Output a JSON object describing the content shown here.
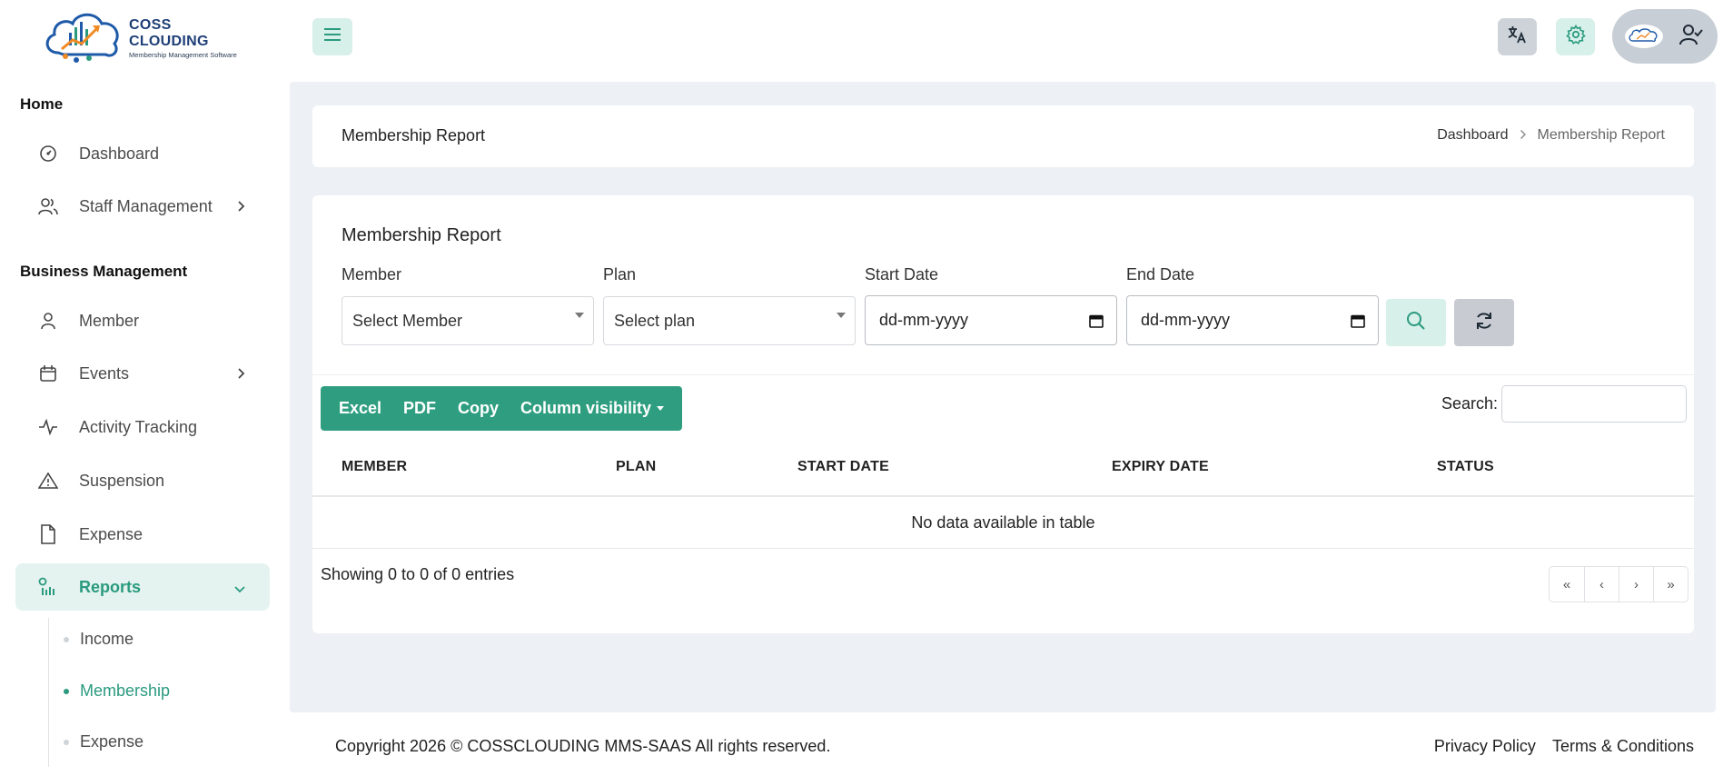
{
  "brand": {
    "name": "COSS CLOUDING",
    "tagline": "Membership Management Software"
  },
  "sidebar": {
    "sections": [
      {
        "heading": "Home"
      },
      {
        "heading": "Business Management"
      }
    ],
    "items": [
      {
        "label": "Dashboard",
        "icon": "gauge-icon"
      },
      {
        "label": "Staff Management",
        "icon": "users-icon"
      },
      {
        "label": "Member",
        "icon": "user-icon"
      },
      {
        "label": "Events",
        "icon": "calendar-icon"
      },
      {
        "label": "Activity Tracking",
        "icon": "activity-icon"
      },
      {
        "label": "Suspension",
        "icon": "warning-icon"
      },
      {
        "label": "Expense",
        "icon": "file-icon"
      },
      {
        "label": "Reports",
        "icon": "reports-icon",
        "active": true
      }
    ],
    "report_subitems": [
      {
        "label": "Income"
      },
      {
        "label": "Membership",
        "active": true
      },
      {
        "label": "Expense"
      }
    ]
  },
  "header": {
    "menu_icon": "hamburger-icon",
    "language_icon": "translate-icon",
    "settings_icon": "gear-icon",
    "profile_icon": "user-check-icon"
  },
  "breadcrumb": {
    "page_title": "Membership Report",
    "home": "Dashboard",
    "current": "Membership Report"
  },
  "report": {
    "title": "Membership Report",
    "filters": {
      "member_label": "Member",
      "member_value": "Select Member",
      "plan_label": "Plan",
      "plan_value": "Select plan",
      "start_label": "Start Date",
      "start_value": "dd-mm-yyyy",
      "end_label": "End Date",
      "end_value": "dd-mm-yyyy"
    },
    "export_buttons": [
      "Excel",
      "PDF",
      "Copy",
      "Column visibility"
    ],
    "search_label": "Search:",
    "columns": [
      "MEMBER",
      "PLAN",
      "START DATE",
      "EXPIRY DATE",
      "STATUS"
    ],
    "empty_message": "No data available in table",
    "info": "Showing 0 to 0 of 0 entries",
    "pagination": [
      "«",
      "‹",
      "›",
      "»"
    ]
  },
  "footer": {
    "copyright": "Copyright 2026 © COSSCLOUDING MMS-SAAS All rights reserved.",
    "privacy": "Privacy Policy",
    "terms": "Terms & Conditions"
  },
  "colors": {
    "accent": "#2f9e80",
    "accent_light": "#d8f0ea",
    "content_bg": "#edf0f4"
  }
}
